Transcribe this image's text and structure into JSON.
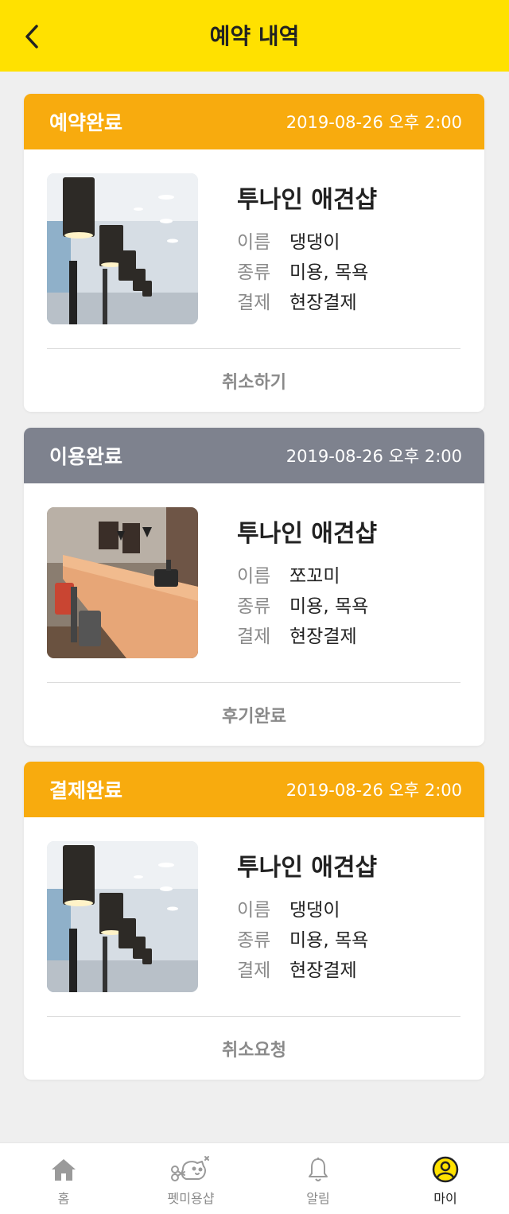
{
  "header": {
    "title": "예약 내역",
    "back_icon": "chevron-left-icon"
  },
  "colors": {
    "topbar": "#ffe100",
    "status_active": "#f8ab0e",
    "status_done": "#7e828e"
  },
  "reservations": [
    {
      "status": "예약완료",
      "datetime": "2019-08-26 오후 2:00",
      "shop_name": "투나인 애견샵",
      "name_key": "이름",
      "name_val": "댕댕이",
      "type_key": "종류",
      "type_val": "미용, 목욕",
      "pay_key": "결제",
      "pay_val": "현장결제",
      "action": "취소하기",
      "image": "salon-lamps-photo"
    },
    {
      "status": "이용완료",
      "datetime": "2019-08-26 오후 2:00",
      "shop_name": "투나인 애견샵",
      "name_key": "이름",
      "name_val": "쪼꼬미",
      "type_key": "종류",
      "type_val": "미용, 목욕",
      "pay_key": "결제",
      "pay_val": "현장결제",
      "action": "후기완료",
      "image": "salon-counter-photo"
    },
    {
      "status": "결제완료",
      "datetime": "2019-08-26 오후 2:00",
      "shop_name": "투나인 애견샵",
      "name_key": "이름",
      "name_val": "댕댕이",
      "type_key": "종류",
      "type_val": "미용, 목욕",
      "pay_key": "결제",
      "pay_val": "현장결제",
      "action": "취소요청",
      "image": "salon-lamps-photo"
    }
  ],
  "tabbar": {
    "items": [
      {
        "label": "홈",
        "icon": "home-icon"
      },
      {
        "label": "펫미용샵",
        "icon": "dog-grooming-icon"
      },
      {
        "label": "알림",
        "icon": "bell-icon"
      },
      {
        "label": "마이",
        "icon": "user-circle-icon",
        "active": true
      }
    ]
  }
}
